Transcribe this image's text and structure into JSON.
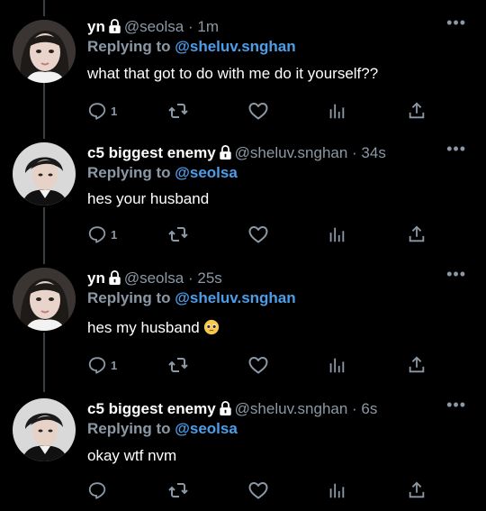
{
  "tweets": [
    {
      "name": "yn",
      "handle": "@seolsa",
      "time": "· 1m",
      "reply_prefix": "Replying to",
      "reply_to": "@sheluv.snghan",
      "text": "what that got to do with me do it yourself??",
      "reply_count": "1",
      "avatar": "girl-avatar"
    },
    {
      "name": "c5 biggest enemy",
      "handle": "@sheluv.snghan",
      "time": "· 34s",
      "reply_prefix": "Replying to",
      "reply_to": "@seolsa",
      "text": "hes your husband",
      "reply_count": "1",
      "avatar": "boy-avatar"
    },
    {
      "name": "yn",
      "handle": "@seolsa",
      "time": "· 25s",
      "reply_prefix": "Replying to",
      "reply_to": "@sheluv.snghan",
      "text": "hes my husband",
      "reply_count": "1",
      "avatar": "girl-avatar"
    },
    {
      "name": "c5 biggest enemy",
      "handle": "@sheluv.snghan",
      "time": "· 6s",
      "reply_prefix": "Replying to",
      "reply_to": "@seolsa",
      "text": "okay wtf nvm",
      "reply_count": "",
      "avatar": "boy-avatar"
    }
  ],
  "more_label": "•••",
  "colors": {
    "background": "#000000",
    "link": "#4d9ee9",
    "muted": "#8b98a5",
    "text": "#ffffff"
  }
}
